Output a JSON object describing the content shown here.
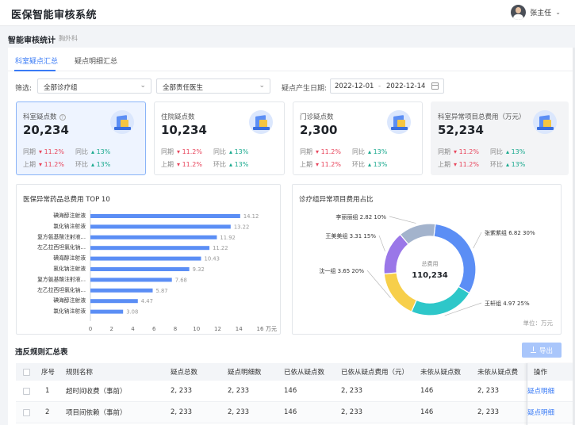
{
  "app": {
    "title": "医保智能审核系统",
    "user_name": "张主任"
  },
  "page": {
    "title": "智能审核统计",
    "subtitle": "胸外科"
  },
  "tabs": [
    {
      "label": "科室疑点汇总",
      "active": true
    },
    {
      "label": "疑点明细汇总",
      "active": false
    }
  ],
  "filters": {
    "label": "筛选:",
    "group_select": "全部诊疗组",
    "doctor_select": "全部责任医生",
    "date_label": "疑点产生日期:",
    "date_start": "2022-12-01",
    "date_sep": "-",
    "date_end": "2022-12-14"
  },
  "cards": [
    {
      "title": "科室疑点数",
      "value": "20,234",
      "r1l": "同期",
      "r1v": "11.2%",
      "r1cl": "同比",
      "r1cv": "13%",
      "r2l": "上期",
      "r2v": "11.2%",
      "r2cl": "环比",
      "r2cv": "13%"
    },
    {
      "title": "住院疑点数",
      "value": "10,234",
      "r1l": "同期",
      "r1v": "11.2%",
      "r1cl": "同比",
      "r1cv": "13%",
      "r2l": "上期",
      "r2v": "11.2%",
      "r2cl": "环比",
      "r2cv": "13%"
    },
    {
      "title": "门诊疑点数",
      "value": "2,300",
      "r1l": "同期",
      "r1v": "11.2%",
      "r1cl": "同比",
      "r1cv": "13%",
      "r2l": "上期",
      "r2v": "11.2%",
      "r2cl": "环比",
      "r2cv": "13%"
    },
    {
      "title": "科室异常项目总费用（万元）",
      "value": "52,234",
      "r1l": "同期",
      "r1v": "11.2%",
      "r1cl": "同比",
      "r1cv": "13%",
      "r2l": "上期",
      "r2v": "11.2%",
      "r2cl": "环比",
      "r2cv": "13%"
    }
  ],
  "colors": {
    "accent": "#3a7bf6",
    "bar": "#5b8ef5",
    "up": "#19a98e",
    "down": "#e8455c"
  },
  "chart_data": [
    {
      "type": "bar",
      "orientation": "horizontal",
      "title": "医保异常药品总费用 TOP 10",
      "unit_label": "万元",
      "categories": [
        "碘海醇注射液",
        "氯化钠注射液",
        "复方氨基酸注射液...",
        "左乙拉西坦氯化钠...",
        "碘海醇注射液",
        "氯化钠注射液",
        "复方氨基酸注射液...",
        "左乙拉西坦氯化钠...",
        "碘海醇注射液",
        "氯化钠注射液"
      ],
      "values": [
        14.12,
        13.22,
        11.92,
        11.22,
        10.43,
        9.32,
        7.68,
        5.87,
        4.47,
        3.08
      ],
      "xlim": [
        0,
        16
      ],
      "xticks": [
        "0",
        "2",
        "4",
        "6",
        "8",
        "10",
        "12",
        "14",
        "16"
      ],
      "grid": true
    },
    {
      "type": "pie",
      "style": "donut",
      "title": "诊疗组异常项目费用占比",
      "center_label": "总费用",
      "center_value": "110,234",
      "unit_text": "单位：万元",
      "slices": [
        {
          "name": "张紫紫组",
          "value": 6.82,
          "pct": "30%",
          "color": "#5b8ef5"
        },
        {
          "name": "王轩组",
          "value": 4.97,
          "pct": "25%",
          "color": "#2ec7c9"
        },
        {
          "name": "沈一组",
          "value": 3.65,
          "pct": "20%",
          "color": "#f7cf4a"
        },
        {
          "name": "王美美组",
          "value": 3.31,
          "pct": "15%",
          "color": "#9a77e8"
        },
        {
          "name": "李丽丽组",
          "value": 2.82,
          "pct": "10%",
          "color": "#a3b3cc"
        }
      ]
    }
  ],
  "table": {
    "title": "违反规则汇总表",
    "export_label": "导出",
    "headers": [
      "序号",
      "规则名称",
      "疑点总数",
      "疑点明细数",
      "已依从疑点数",
      "已依从疑点费用（元）",
      "未依从疑点数",
      "未依从疑点费",
      "操作"
    ],
    "rows": [
      {
        "no": "1",
        "name": "超时间收费（事前）",
        "total": "2, 233",
        "detail": "2, 233",
        "followed": "146",
        "followed_fee": "2, 233",
        "unfollowed": "146",
        "unfollowed_fee": "2, 233",
        "action": "疑点明细"
      },
      {
        "no": "2",
        "name": "项目间依赖（事前）",
        "total": "2, 233",
        "detail": "2, 233",
        "followed": "146",
        "followed_fee": "2, 233",
        "unfollowed": "146",
        "unfollowed_fee": "2, 233",
        "action": "疑点明细"
      }
    ]
  }
}
